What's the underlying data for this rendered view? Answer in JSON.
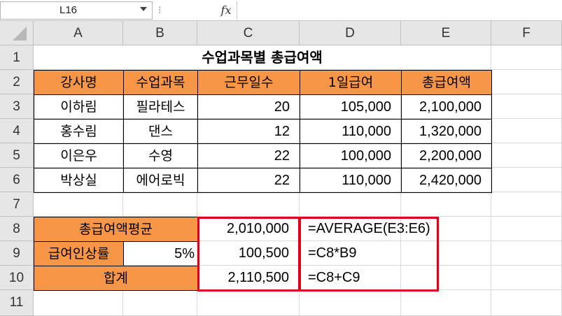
{
  "formula_bar": {
    "name_box": "L16",
    "fx_label": "fx",
    "formula": ""
  },
  "columns": [
    "A",
    "B",
    "C",
    "D",
    "E",
    "F"
  ],
  "rows": [
    "1",
    "2",
    "3",
    "4",
    "5",
    "6",
    "7",
    "8",
    "9",
    "10",
    "11"
  ],
  "title": "수업과목별 총급여액",
  "headers": [
    "강사명",
    "수업과목",
    "근무일수",
    "1일급여",
    "총급여액"
  ],
  "table_rows": [
    {
      "name": "이하림",
      "subject": "필라테스",
      "days": "20",
      "daily": "105,000",
      "total": "2,100,000"
    },
    {
      "name": "홍수림",
      "subject": "댄스",
      "days": "12",
      "daily": "110,000",
      "total": "1,320,000"
    },
    {
      "name": "이은우",
      "subject": "수영",
      "days": "22",
      "daily": "100,000",
      "total": "2,200,000"
    },
    {
      "name": "박상실",
      "subject": "에어로빅",
      "days": "22",
      "daily": "110,000",
      "total": "2,420,000"
    }
  ],
  "summary": {
    "avg_label": "총급여액평균",
    "avg_value": "2,010,000",
    "avg_formula": "=AVERAGE(E3:E6)",
    "rate_label": "급여인상률",
    "rate_value": "5%",
    "raise_value": "100,500",
    "raise_formula": "=C8*B9",
    "sum_label": "합계",
    "sum_value": "2,110,500",
    "sum_formula": "=C8+C9"
  },
  "colors": {
    "header_fill": "#f79646",
    "highlight_border": "#e0001b",
    "grid_header": "#e6e6e6"
  }
}
